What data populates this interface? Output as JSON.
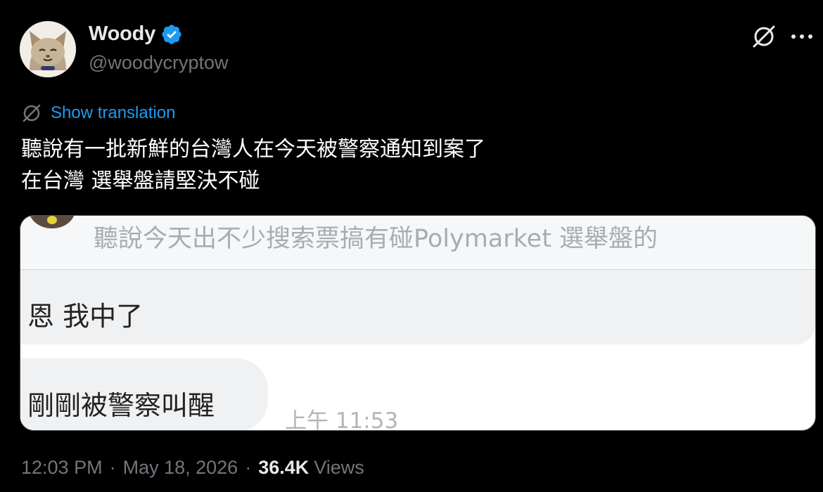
{
  "author": {
    "name": "Woody",
    "handle": "@woodycryptow"
  },
  "translate": {
    "label": "Show translation"
  },
  "tweet": {
    "lines": [
      "聽說有一批新鮮的台灣人在今天被警察通知到案了",
      "在台灣 選舉盤請堅決不碰"
    ]
  },
  "media": {
    "quoted_message": "聽說今天出不少搜索票搞有碰Polymarket 選舉盤的",
    "message_1": "恩 我中了",
    "message_2": "剛剛被警察叫醒",
    "timestamp": "上午 11:53"
  },
  "meta": {
    "time": "12:03 PM",
    "separator": "·",
    "date": "May 18, 2026",
    "views_count": "36.4K",
    "views_label": "Views"
  },
  "colors": {
    "link": "#1d9bf0",
    "verified": "#1d9bf0",
    "muted": "#71767b",
    "background": "#000000"
  },
  "icons": [
    "verified-badge-icon",
    "grok-icon",
    "more-icon",
    "translate-icon"
  ]
}
